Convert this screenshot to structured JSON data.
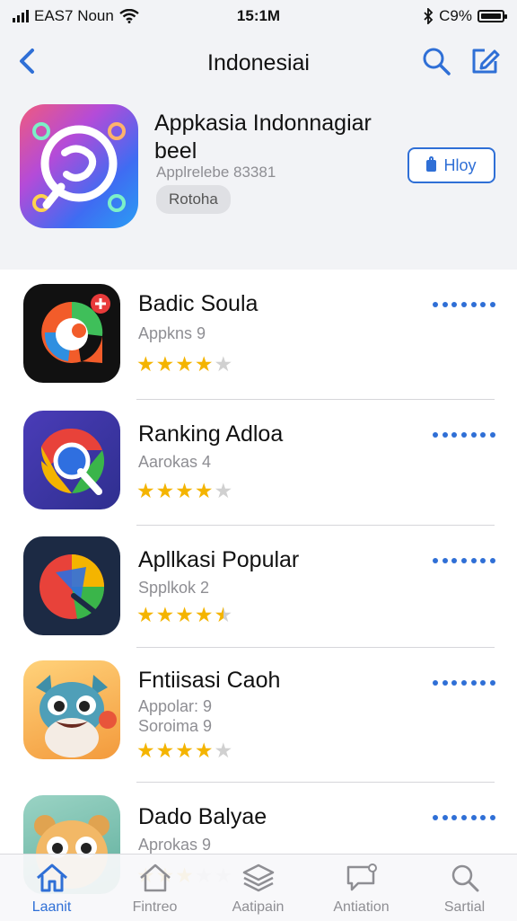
{
  "status_bar": {
    "carrier": "EAS7 Noun",
    "time": "15:1M",
    "battery": "C9%"
  },
  "nav": {
    "title": "Indonesiai"
  },
  "featured": {
    "title": "Appkasia Indonnagiar beel",
    "subtitle": "Applrelebe 83381",
    "tag": "Rotoha",
    "button_label": "Hloy"
  },
  "apps": [
    {
      "name": "Badic Soula",
      "sub": [
        "Appkns 9"
      ],
      "rating": 4
    },
    {
      "name": "Ranking Adloa",
      "sub": [
        "Aarokas 4"
      ],
      "rating": 4
    },
    {
      "name": "Apllkasi Popular",
      "sub": [
        "Spplkok 2"
      ],
      "rating": 4.5
    },
    {
      "name": "Fntiisasi  Caoh",
      "sub": [
        "Appolar: 9",
        "Soroima 9"
      ],
      "rating": 4
    },
    {
      "name": "Dado Balyae",
      "sub": [
        "Aprokas 9"
      ],
      "rating": 3
    }
  ],
  "tabs": [
    {
      "label": "Laanit",
      "icon": "home-icon",
      "active": true
    },
    {
      "label": "Fintreo",
      "icon": "home-outline-icon",
      "active": false
    },
    {
      "label": "Aatipain",
      "icon": "stack-icon",
      "active": false
    },
    {
      "label": "Antiation",
      "icon": "message-icon",
      "active": false
    },
    {
      "label": "Sartial",
      "icon": "search-icon",
      "active": false
    }
  ],
  "colors": {
    "accent": "#2f6fd6",
    "star": "#f4b400",
    "header_bg": "#f2f3f6"
  }
}
